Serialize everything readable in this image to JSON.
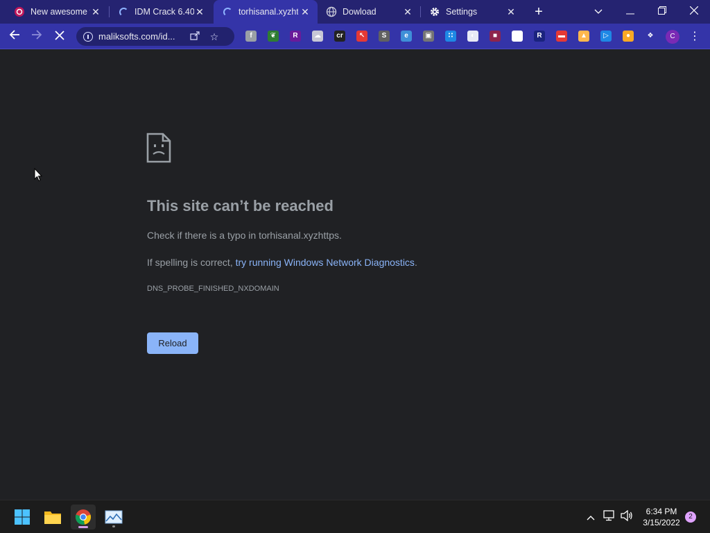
{
  "browser": {
    "tabs": [
      {
        "title": "New awesome t",
        "icon": "site-favicon-icon",
        "active": false
      },
      {
        "title": "IDM Crack 6.40",
        "icon": "loading-spinner-icon",
        "active": false
      },
      {
        "title": "torhisanal.xyzht",
        "icon": "loading-spinner-icon",
        "active": true
      },
      {
        "title": "Dowload",
        "icon": "globe-icon",
        "active": false
      },
      {
        "title": "Settings",
        "icon": "gear-icon",
        "active": false
      }
    ],
    "new_tab_icon": "plus-icon",
    "window_controls": [
      "chevron-down-icon",
      "minimize-icon",
      "restore-icon",
      "close-icon"
    ],
    "url": "maliksofts.com/id...",
    "extensions": [
      {
        "name": "extension-f-icon",
        "label": "f",
        "color": "#9aa0a6"
      },
      {
        "name": "extension-leaf-icon",
        "label": "❦",
        "color": "#2e7d32"
      },
      {
        "name": "extension-r-purple-icon",
        "label": "R",
        "color": "#6a1b9a"
      },
      {
        "name": "extension-cloud-icon",
        "label": "☁",
        "color": "#c7c7d6"
      },
      {
        "name": "extension-cr-icon",
        "label": "cr",
        "color": "#222222"
      },
      {
        "name": "extension-cursor-icon",
        "label": "↖",
        "color": "#e53935"
      },
      {
        "name": "extension-s-icon",
        "label": "S",
        "color": "#616161"
      },
      {
        "name": "extension-edge-icon",
        "label": "e",
        "color": "#3f8fd8"
      },
      {
        "name": "extension-gray-icon",
        "label": "▣",
        "color": "#757575"
      },
      {
        "name": "extension-grid-icon",
        "label": "∷",
        "color": "#1e88e5"
      },
      {
        "name": "extension-circle-icon",
        "label": "◐",
        "color": "#e8eaf6"
      },
      {
        "name": "extension-square-icon",
        "label": "■",
        "color": "#8e244d"
      },
      {
        "name": "extension-diamond-icon",
        "label": "◈",
        "color": "#ffffff"
      },
      {
        "name": "extension-r-blue-icon",
        "label": "R",
        "color": "#1a237e"
      },
      {
        "name": "extension-card-icon",
        "label": "▬",
        "color": "#e53935"
      },
      {
        "name": "extension-lock-icon",
        "label": "▲",
        "color": "#ffb74d"
      },
      {
        "name": "extension-play-icon",
        "label": "▷",
        "color": "#1e88e5"
      },
      {
        "name": "extension-monkey-icon",
        "label": "●",
        "color": "#f9a825"
      },
      {
        "name": "extensions-puzzle-icon",
        "label": "❖",
        "color": "#3434a8"
      }
    ],
    "profile_initial": "C",
    "menu_icon": "⋮"
  },
  "error_page": {
    "title": "This site can’t be reached",
    "line1": "Check if there is a typo in torhisanal.xyzhttps.",
    "line2_prefix": "If spelling is correct, ",
    "line2_link": "try running Windows Network Diagnostics",
    "line2_suffix": ".",
    "error_code": "DNS_PROBE_FINISHED_NXDOMAIN",
    "reload_label": "Reload"
  },
  "taskbar": {
    "apps": [
      "windows-start-icon",
      "file-explorer-icon",
      "chrome-icon",
      "photo-app-icon"
    ],
    "tray": [
      "chevron-up-icon",
      "network-icon",
      "volume-icon"
    ],
    "time": "6:34 PM",
    "date": "3/15/2022",
    "notification_count": "2"
  }
}
